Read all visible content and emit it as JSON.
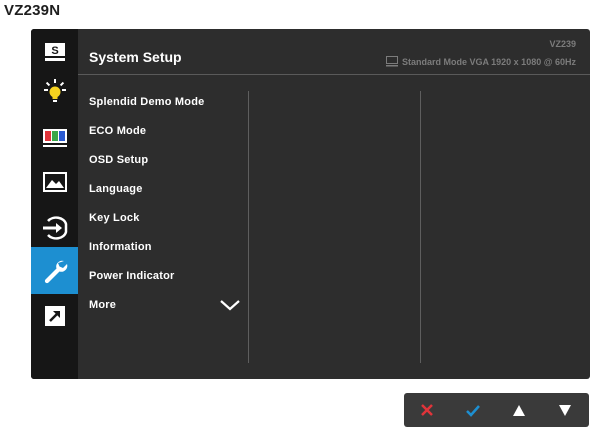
{
  "model_label": "VZ239N",
  "header": {
    "title": "System Setup",
    "model": "VZ239",
    "status": "Standard Mode VGA  1920 x 1080 @ 60Hz"
  },
  "sidebar": {
    "items": [
      {
        "name": "splendid",
        "icon": "s-icon",
        "label": "S",
        "active": false
      },
      {
        "name": "blue-light",
        "icon": "lightbulb-icon",
        "active": false
      },
      {
        "name": "color",
        "icon": "color-bars-icon",
        "active": false
      },
      {
        "name": "image",
        "icon": "mountain-image-icon",
        "active": false
      },
      {
        "name": "input-select",
        "icon": "input-icon",
        "active": false
      },
      {
        "name": "system-setup",
        "icon": "wrench-icon",
        "active": true
      },
      {
        "name": "shortcut",
        "icon": "shortcut-arrow-icon",
        "active": false
      }
    ]
  },
  "menu": {
    "items": [
      "Splendid Demo Mode",
      "ECO Mode",
      "OSD Setup",
      "Language",
      "Key Lock",
      "Information",
      "Power Indicator",
      "More"
    ]
  },
  "keys": [
    {
      "name": "cancel",
      "icon": "x-icon",
      "color": "#e0343a"
    },
    {
      "name": "confirm",
      "icon": "check-icon",
      "color": "#1d8fd1"
    },
    {
      "name": "up",
      "icon": "triangle-up-icon",
      "color": "#ffffff"
    },
    {
      "name": "down",
      "icon": "triangle-down-icon",
      "color": "#ffffff"
    }
  ],
  "colors": {
    "accent": "#1d8fd1",
    "panel": "#2d2d2d",
    "sidebar": "#161616"
  }
}
